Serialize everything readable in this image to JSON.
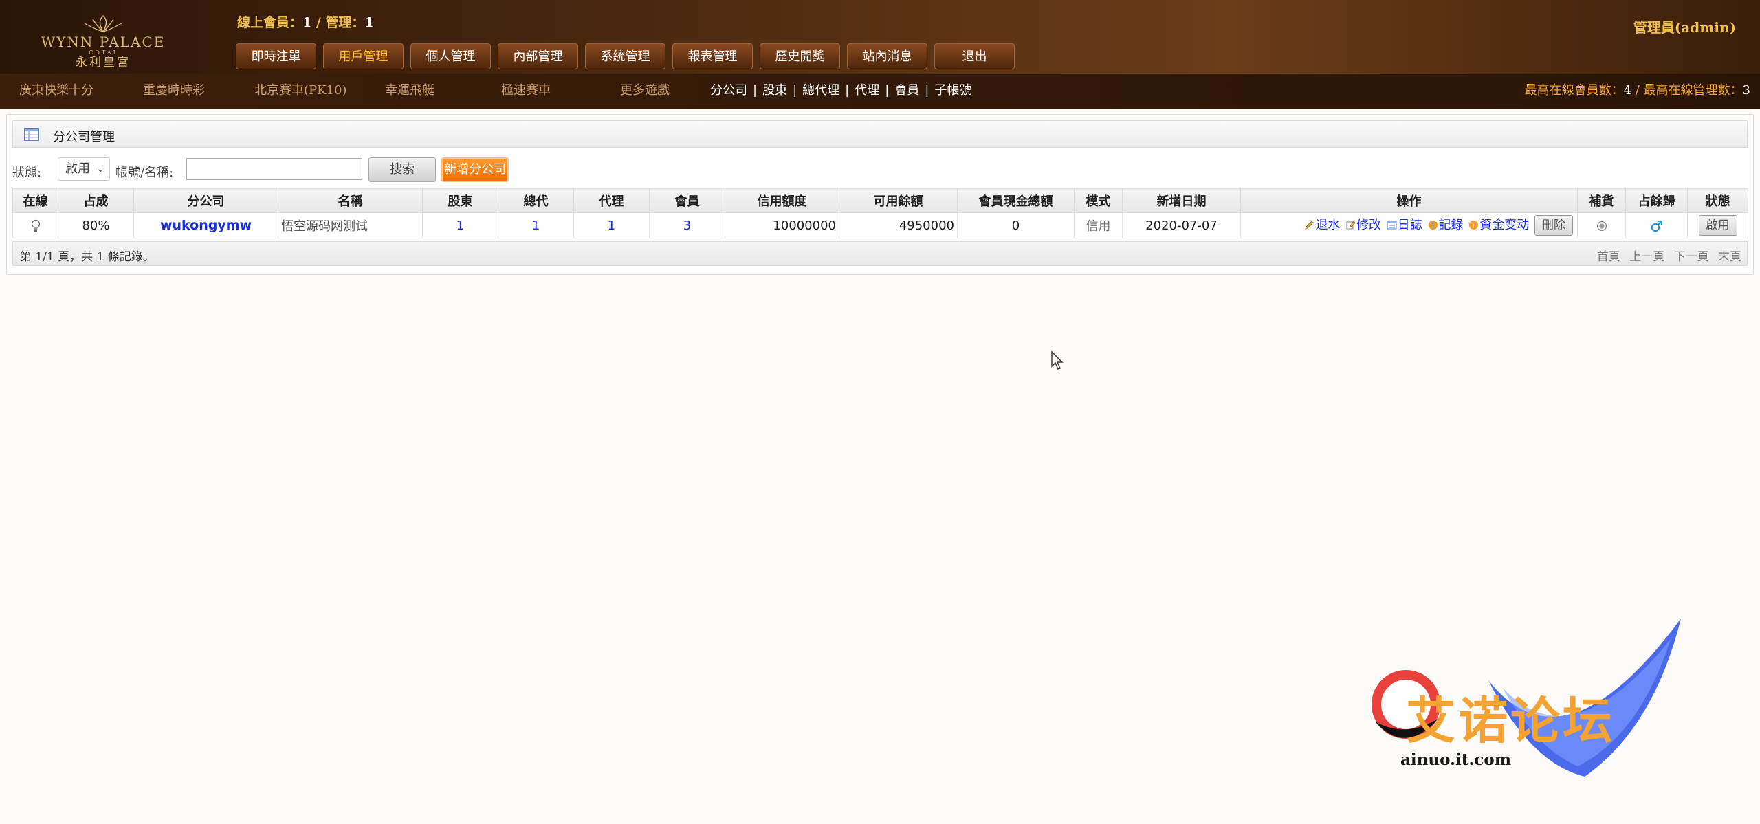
{
  "header": {
    "logo_brand": "WYNN PALACE",
    "logo_sub": "COTAI",
    "logo_cn": "永利皇宮",
    "online_label": "線上會員：",
    "online_members": "1",
    "online_sep": " / 管理：",
    "online_admins": "1",
    "admin_text": "管理員(admin)",
    "nav": [
      "即時注單",
      "用戶管理",
      "個人管理",
      "內部管理",
      "系統管理",
      "報表管理",
      "歷史開獎",
      "站內消息",
      "退出"
    ],
    "nav_active_index": 1
  },
  "subbar": {
    "games": [
      "廣東快樂十分",
      "重慶時時彩",
      "北京賽車(PK10)",
      "幸運飛艇",
      "極速賽車",
      "更多遊戲"
    ],
    "roles": [
      "分公司",
      "股東",
      "總代理",
      "代理",
      "會員",
      "子帳號"
    ],
    "max_members_label": "最高在線會員數：",
    "max_members": "4",
    "max_admins_label": " / 最高在線管理數：",
    "max_admins": "3"
  },
  "panel": {
    "title": "分公司管理",
    "status_label": "狀態:",
    "status_value": "啟用",
    "account_label": "帳號/名稱:",
    "search_value": "",
    "search_button": "搜索",
    "add_button": "新增分公司"
  },
  "table": {
    "headers": [
      "在線",
      "占成",
      "分公司",
      "名稱",
      "股東",
      "總代",
      "代理",
      "會員",
      "信用額度",
      "可用餘額",
      "會員現金總額",
      "模式",
      "新增日期",
      "操作",
      "補貨",
      "占餘歸",
      "狀態"
    ],
    "rows": [
      {
        "share": "80%",
        "company": "wukongymw",
        "name": "悟空源码网测试",
        "shareholders": "1",
        "general_agents": "1",
        "agents": "1",
        "members": "3",
        "credit": "10000000",
        "available": "4950000",
        "cash_total": "0",
        "mode": "信用",
        "date": "2020-07-07",
        "ops": [
          "退水",
          "修改",
          "日誌",
          "記錄",
          "資金变动"
        ],
        "delete_label": "刪除",
        "status_button": "啟用"
      }
    ]
  },
  "pager": {
    "info": "第 1/1 頁，共 1 條記錄。",
    "links": [
      "首頁",
      "上一頁",
      "下一頁",
      "末頁"
    ]
  },
  "watermark": {
    "cn": "艾诺论坛",
    "url": "ainuo.it.com"
  },
  "colors": {
    "accent_gold": "#f0c050",
    "link_blue": "#1a2fd6",
    "add_orange": "#f07000"
  }
}
